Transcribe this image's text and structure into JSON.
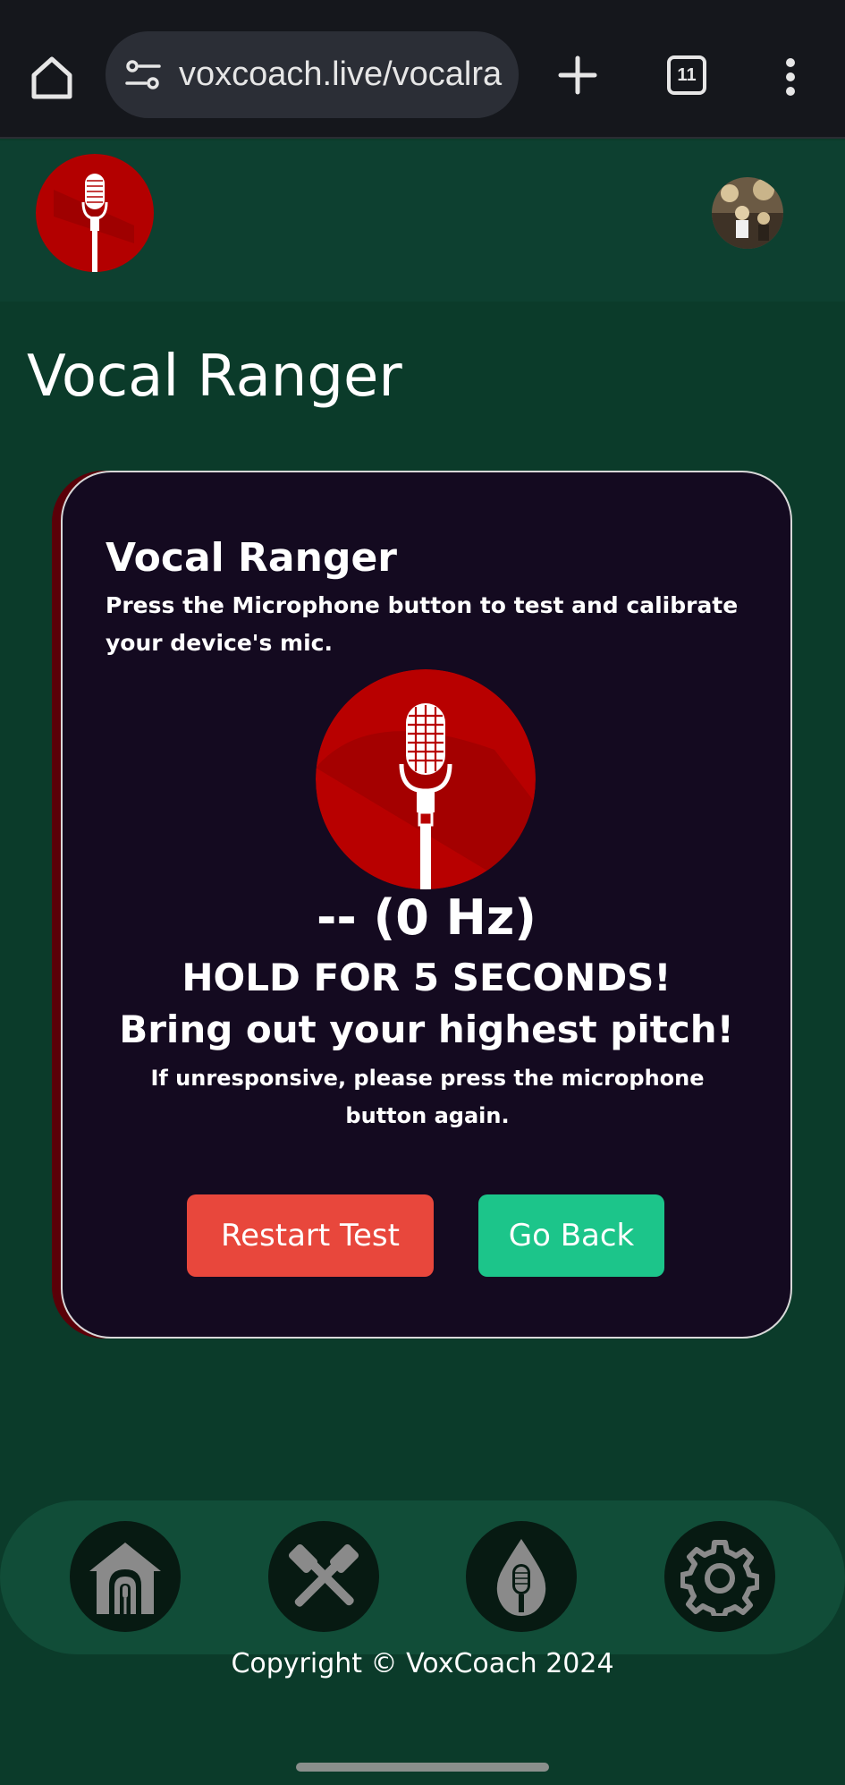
{
  "browser": {
    "url": "voxcoach.live/vocalra",
    "tab_count": "11",
    "icons": [
      "home-icon",
      "tune-icon",
      "plus-icon",
      "tabs-icon",
      "more-vert-icon"
    ]
  },
  "header": {
    "logo_icon": "microphone-logo-icon",
    "avatar_icon": "user-avatar"
  },
  "page": {
    "title": "Vocal Ranger"
  },
  "card": {
    "title": "Vocal Ranger",
    "description": "Press the Microphone button to test and calibrate your device's mic.",
    "mic_icon": "microphone-icon",
    "frequency": "-- (0 Hz)",
    "hold_text": "HOLD FOR 5 SECONDS!",
    "instruction": "Bring out your highest pitch!",
    "hint": "If unresponsive, please press the microphone button again.",
    "restart_label": "Restart Test",
    "back_label": "Go Back"
  },
  "nav": {
    "items": [
      "home-icon",
      "tools-icon",
      "fire-mic-icon",
      "settings-icon"
    ]
  },
  "footer": {
    "copyright": "Copyright © VoxCoach 2024"
  },
  "colors": {
    "background": "#0b3b2a",
    "card": "#140a20",
    "accent_red": "#c00000",
    "restart": "#e8473c",
    "back": "#1cc58a"
  }
}
